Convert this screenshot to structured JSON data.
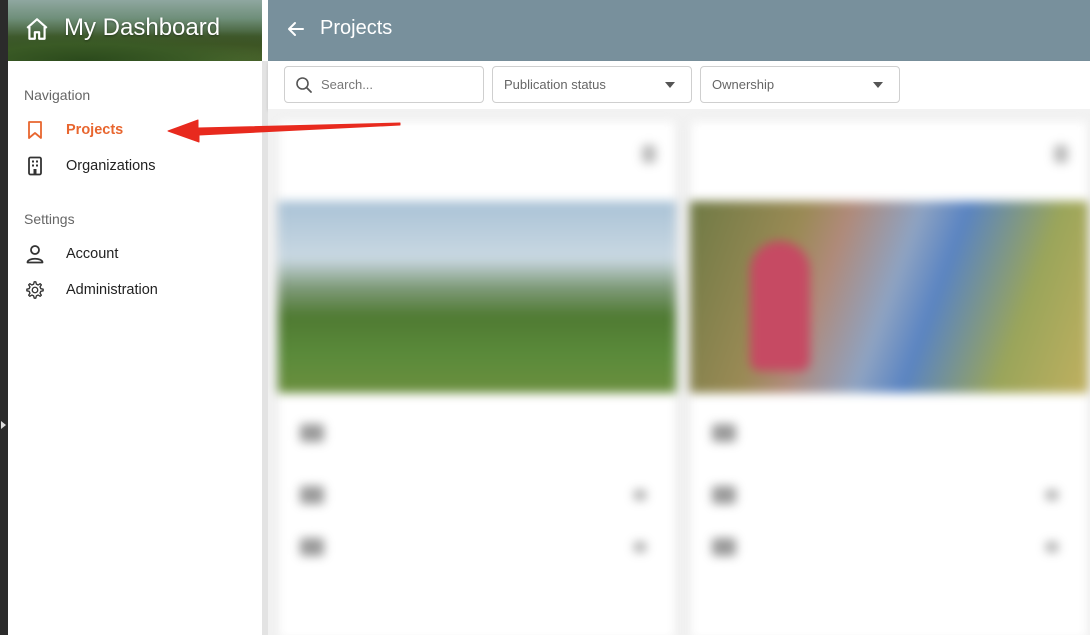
{
  "sidebar": {
    "title": "My Dashboard",
    "sections": [
      {
        "label": "Navigation",
        "items": [
          {
            "label": "Projects",
            "icon": "bookmark-icon",
            "active": true
          },
          {
            "label": "Organizations",
            "icon": "building-icon",
            "active": false
          }
        ]
      },
      {
        "label": "Settings",
        "items": [
          {
            "label": "Account",
            "icon": "person-icon",
            "active": false
          },
          {
            "label": "Administration",
            "icon": "gear-icon",
            "active": false
          }
        ]
      }
    ]
  },
  "topbar": {
    "title": "Projects",
    "back_icon": "arrow-left-icon"
  },
  "filters": {
    "search_placeholder": "Search...",
    "publication_status": "Publication status",
    "ownership": "Ownership"
  },
  "colors": {
    "topbar": "#78909c",
    "accent": "#e8662f",
    "annotation_arrow": "#e82a1e"
  }
}
